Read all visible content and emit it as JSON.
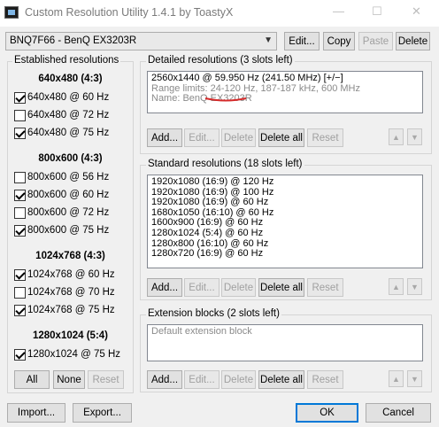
{
  "window": {
    "title": "Custom Resolution Utility 1.4.1 by ToastyX",
    "minimize": "—",
    "maximize": "☐",
    "close": "✕"
  },
  "monitor": {
    "selected": "BNQ7F66 - BenQ EX3203R",
    "dropdown_arrow": "▼"
  },
  "top_buttons": {
    "edit": "Edit...",
    "copy": "Copy",
    "paste": "Paste",
    "delete": "Delete"
  },
  "established": {
    "title": "Established resolutions",
    "sections": [
      {
        "heading": "640x480 (4:3)",
        "items": [
          {
            "label": "640x480 @ 60 Hz",
            "checked": true
          },
          {
            "label": "640x480 @ 72 Hz",
            "checked": false
          },
          {
            "label": "640x480 @ 75 Hz",
            "checked": true
          }
        ]
      },
      {
        "heading": "800x600 (4:3)",
        "items": [
          {
            "label": "800x600 @ 56 Hz",
            "checked": false
          },
          {
            "label": "800x600 @ 60 Hz",
            "checked": true
          },
          {
            "label": "800x600 @ 72 Hz",
            "checked": false
          },
          {
            "label": "800x600 @ 75 Hz",
            "checked": true
          }
        ]
      },
      {
        "heading": "1024x768 (4:3)",
        "items": [
          {
            "label": "1024x768 @ 60 Hz",
            "checked": true
          },
          {
            "label": "1024x768 @ 70 Hz",
            "checked": false
          },
          {
            "label": "1024x768 @ 75 Hz",
            "checked": true
          }
        ]
      },
      {
        "heading": "1280x1024 (5:4)",
        "items": [
          {
            "label": "1280x1024 @ 75 Hz",
            "checked": true
          }
        ]
      }
    ],
    "buttons": {
      "all": "All",
      "none": "None",
      "reset": "Reset"
    }
  },
  "detailed": {
    "title": "Detailed resolutions (3 slots left)",
    "lines": [
      "2560x1440 @ 59.950 Hz (241.50 MHz) [+/−]",
      "Range limits: 24-120 Hz, 187-187 kHz, 600 MHz",
      "Name: BenQ EX3203R"
    ],
    "buttons": {
      "add": "Add...",
      "edit": "Edit...",
      "delete": "Delete",
      "delete_all": "Delete all",
      "reset": "Reset"
    }
  },
  "standard": {
    "title": "Standard resolutions (18 slots left)",
    "rows": [
      "1920x1080 (16:9) @ 120 Hz",
      "1920x1080 (16:9) @ 100 Hz",
      "1920x1080 (16:9) @ 60 Hz",
      "1680x1050 (16:10) @ 60 Hz",
      "1600x900 (16:9) @ 60 Hz",
      "1280x1024 (5:4) @ 60 Hz",
      "1280x800 (16:10) @ 60 Hz",
      "1280x720 (16:9) @ 60 Hz"
    ],
    "buttons": {
      "add": "Add...",
      "edit": "Edit...",
      "delete": "Delete",
      "delete_all": "Delete all",
      "reset": "Reset"
    }
  },
  "extension": {
    "title": "Extension blocks (2 slots left)",
    "rows": [
      "Default extension block"
    ],
    "buttons": {
      "add": "Add...",
      "edit": "Edit...",
      "delete": "Delete",
      "delete_all": "Delete all",
      "reset": "Reset"
    }
  },
  "footer": {
    "import": "Import...",
    "export": "Export...",
    "ok": "OK",
    "cancel": "Cancel"
  },
  "icons": {
    "up": "▲",
    "down": "▼"
  },
  "colors": {
    "annotation_underline": "#d62a2a",
    "default_button_border": "#0078d7"
  }
}
